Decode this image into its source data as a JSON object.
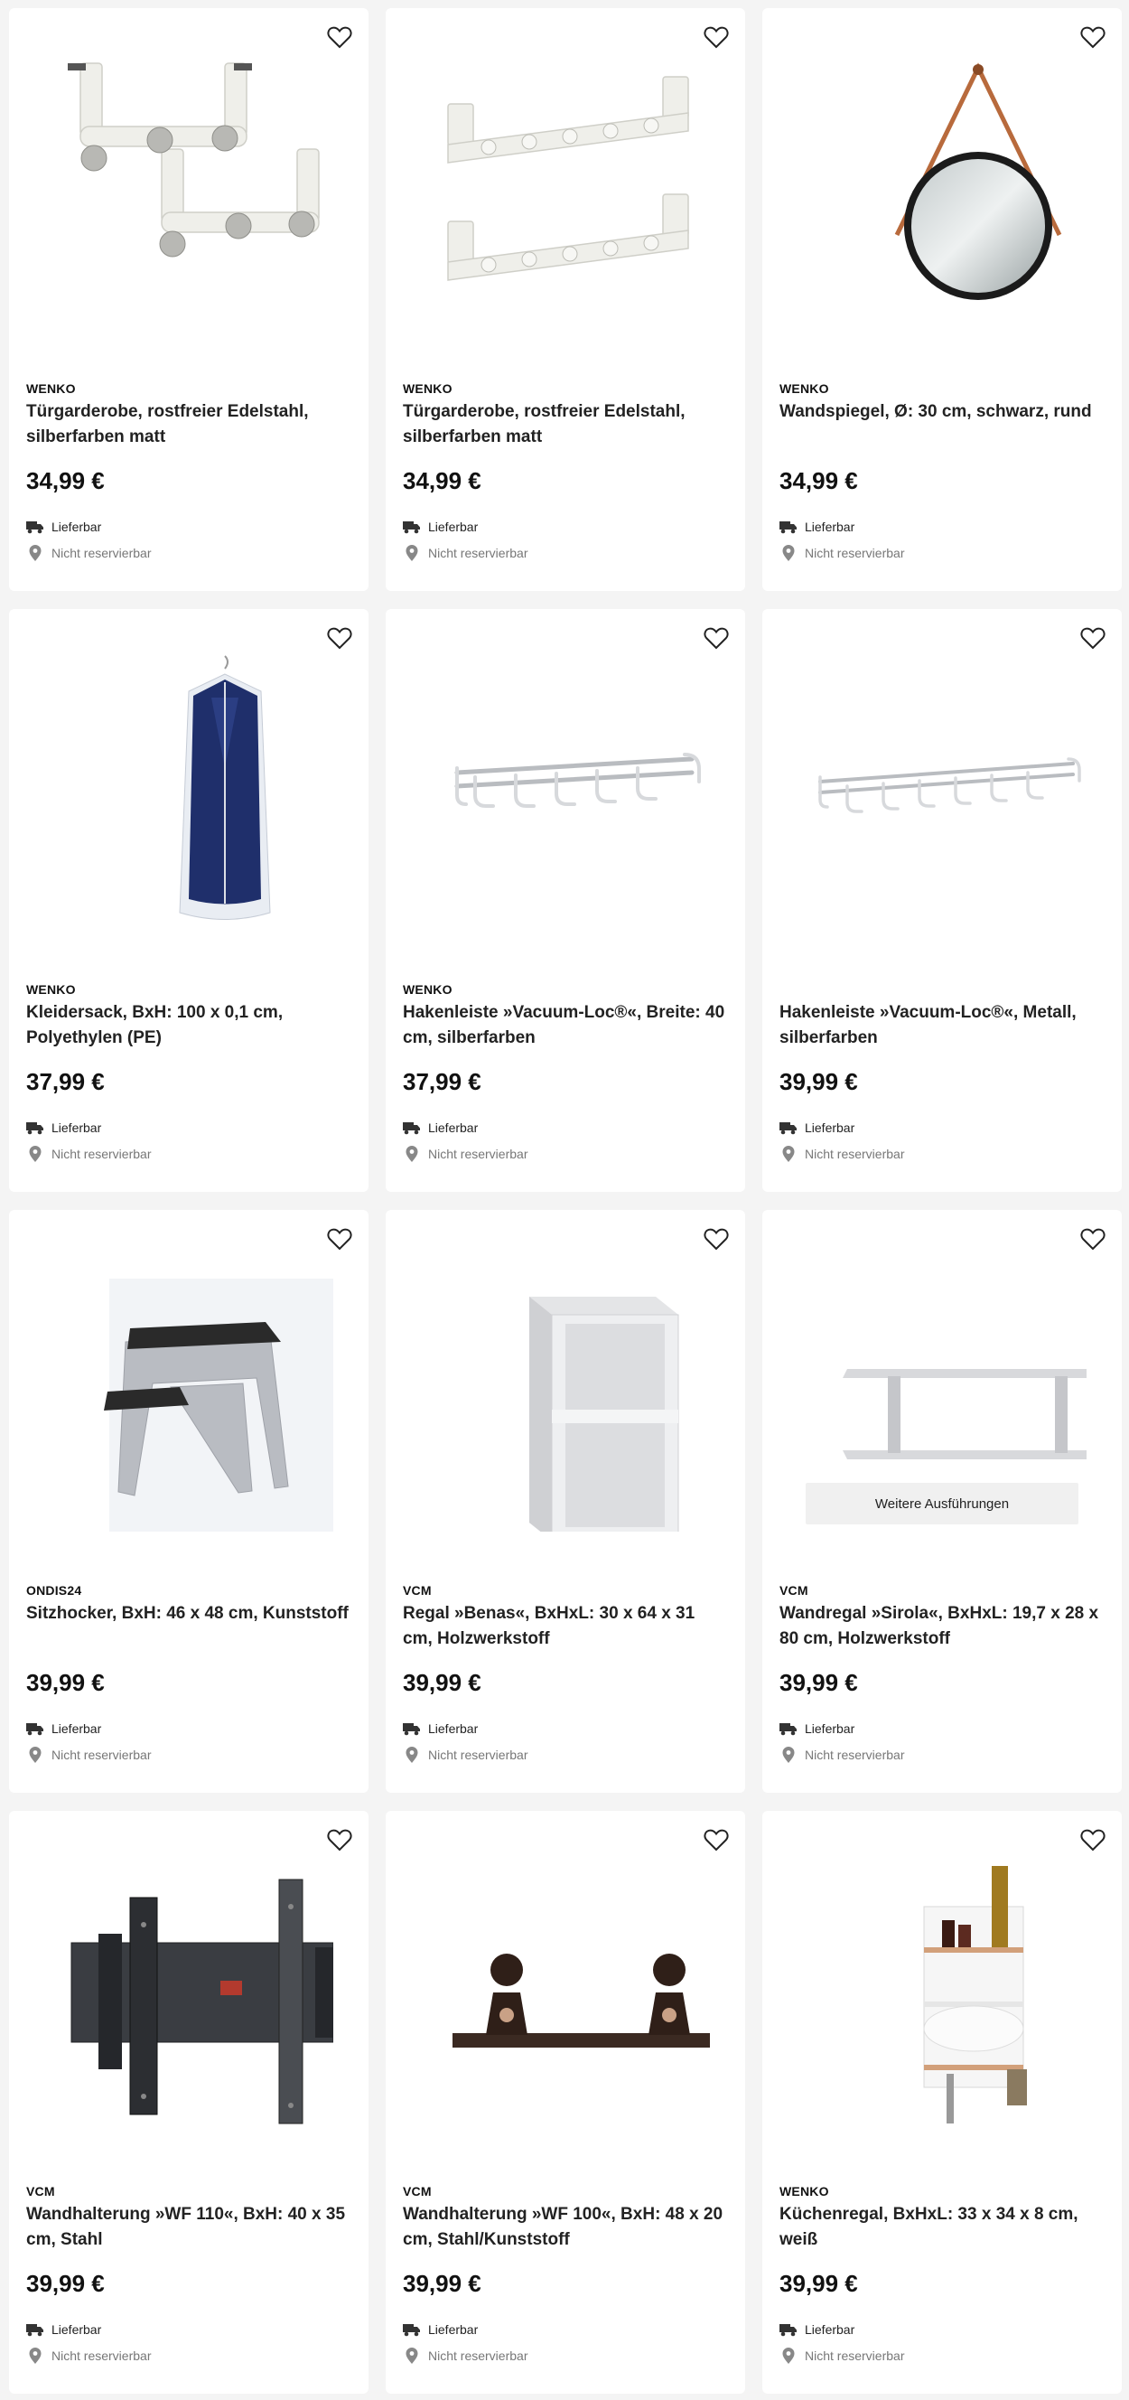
{
  "products": [
    {
      "brand": "WENKO",
      "title": "Türgarderobe, rostfreier Edelstahl, silberfarben matt",
      "price": "34,99 €",
      "delivery": "Lieferbar",
      "store": "Nicht reservierbar",
      "image": "door-hooks-double-image"
    },
    {
      "brand": "WENKO",
      "title": "Türgarderobe, rostfreier Edelstahl, silberfarben matt",
      "price": "34,99 €",
      "delivery": "Lieferbar",
      "store": "Nicht reservierbar",
      "image": "door-hooks-long-image"
    },
    {
      "brand": "WENKO",
      "title": "Wandspiegel, Ø: 30 cm, schwarz, rund",
      "price": "34,99 €",
      "delivery": "Lieferbar",
      "store": "Nicht reservierbar",
      "image": "round-mirror-image"
    },
    {
      "brand": "WENKO",
      "title": "Kleidersack, BxH: 100 x 0,1 cm, Polyethylen (PE)",
      "price": "37,99 €",
      "delivery": "Lieferbar",
      "store": "Nicht reservierbar",
      "image": "garment-bag-image"
    },
    {
      "brand": "WENKO",
      "title": "Hakenleiste »Vacuum-Loc®«, Breite: 40 cm, silberfarben",
      "price": "37,99 €",
      "delivery": "Lieferbar",
      "store": "Nicht reservierbar",
      "image": "hook-rail-image"
    },
    {
      "brand": "",
      "title": "Hakenleiste »Vacuum-Loc®«, Metall, silberfarben",
      "price": "39,99 €",
      "delivery": "Lieferbar",
      "store": "Nicht reservierbar",
      "image": "hook-rail-long-image"
    },
    {
      "brand": "ONDIS24",
      "title": "Sitzhocker, BxH: 46 x 48 cm, Kunststoff",
      "price": "39,99 €",
      "delivery": "Lieferbar",
      "store": "Nicht reservierbar",
      "image": "step-stool-image"
    },
    {
      "brand": "VCM",
      "title": "Regal »Benas«, BxHxL: 30 x 64 x 31 cm, Holzwerkstoff",
      "price": "39,99 €",
      "delivery": "Lieferbar",
      "store": "Nicht reservierbar",
      "image": "shelf-unit-image"
    },
    {
      "brand": "VCM",
      "title": "Wandregal »Sirola«, BxHxL: 19,7 x 28 x 80 cm, Holzwerkstoff",
      "price": "39,99 €",
      "delivery": "Lieferbar",
      "store": "Nicht reservierbar",
      "image": "wall-shelf-image",
      "more_label": "Weitere Ausführungen"
    },
    {
      "brand": "VCM",
      "title": "Wandhalterung »WF 110«, BxH: 40 x 35 cm, Stahl",
      "price": "39,99 €",
      "delivery": "Lieferbar",
      "store": "Nicht reservierbar",
      "image": "tv-mount-image"
    },
    {
      "brand": "VCM",
      "title": "Wandhalterung »WF 100«, BxH: 48 x 20 cm, Stahl/Kunststoff",
      "price": "39,99 €",
      "delivery": "Lieferbar",
      "store": "Nicht reservierbar",
      "image": "speaker-mount-image"
    },
    {
      "brand": "WENKO",
      "title": "Küchenregal, BxHxL: 33 x 34 x 8 cm, weiß",
      "price": "39,99 €",
      "delivery": "Lieferbar",
      "store": "Nicht reservierbar",
      "image": "kitchen-rack-image"
    }
  ],
  "icons": {
    "wishlist": "heart-outline-icon",
    "delivery": "truck-icon",
    "store": "location-pin-icon"
  },
  "colors": {
    "price": "#111111",
    "muted": "#777777",
    "background": "#f4f4f4"
  }
}
